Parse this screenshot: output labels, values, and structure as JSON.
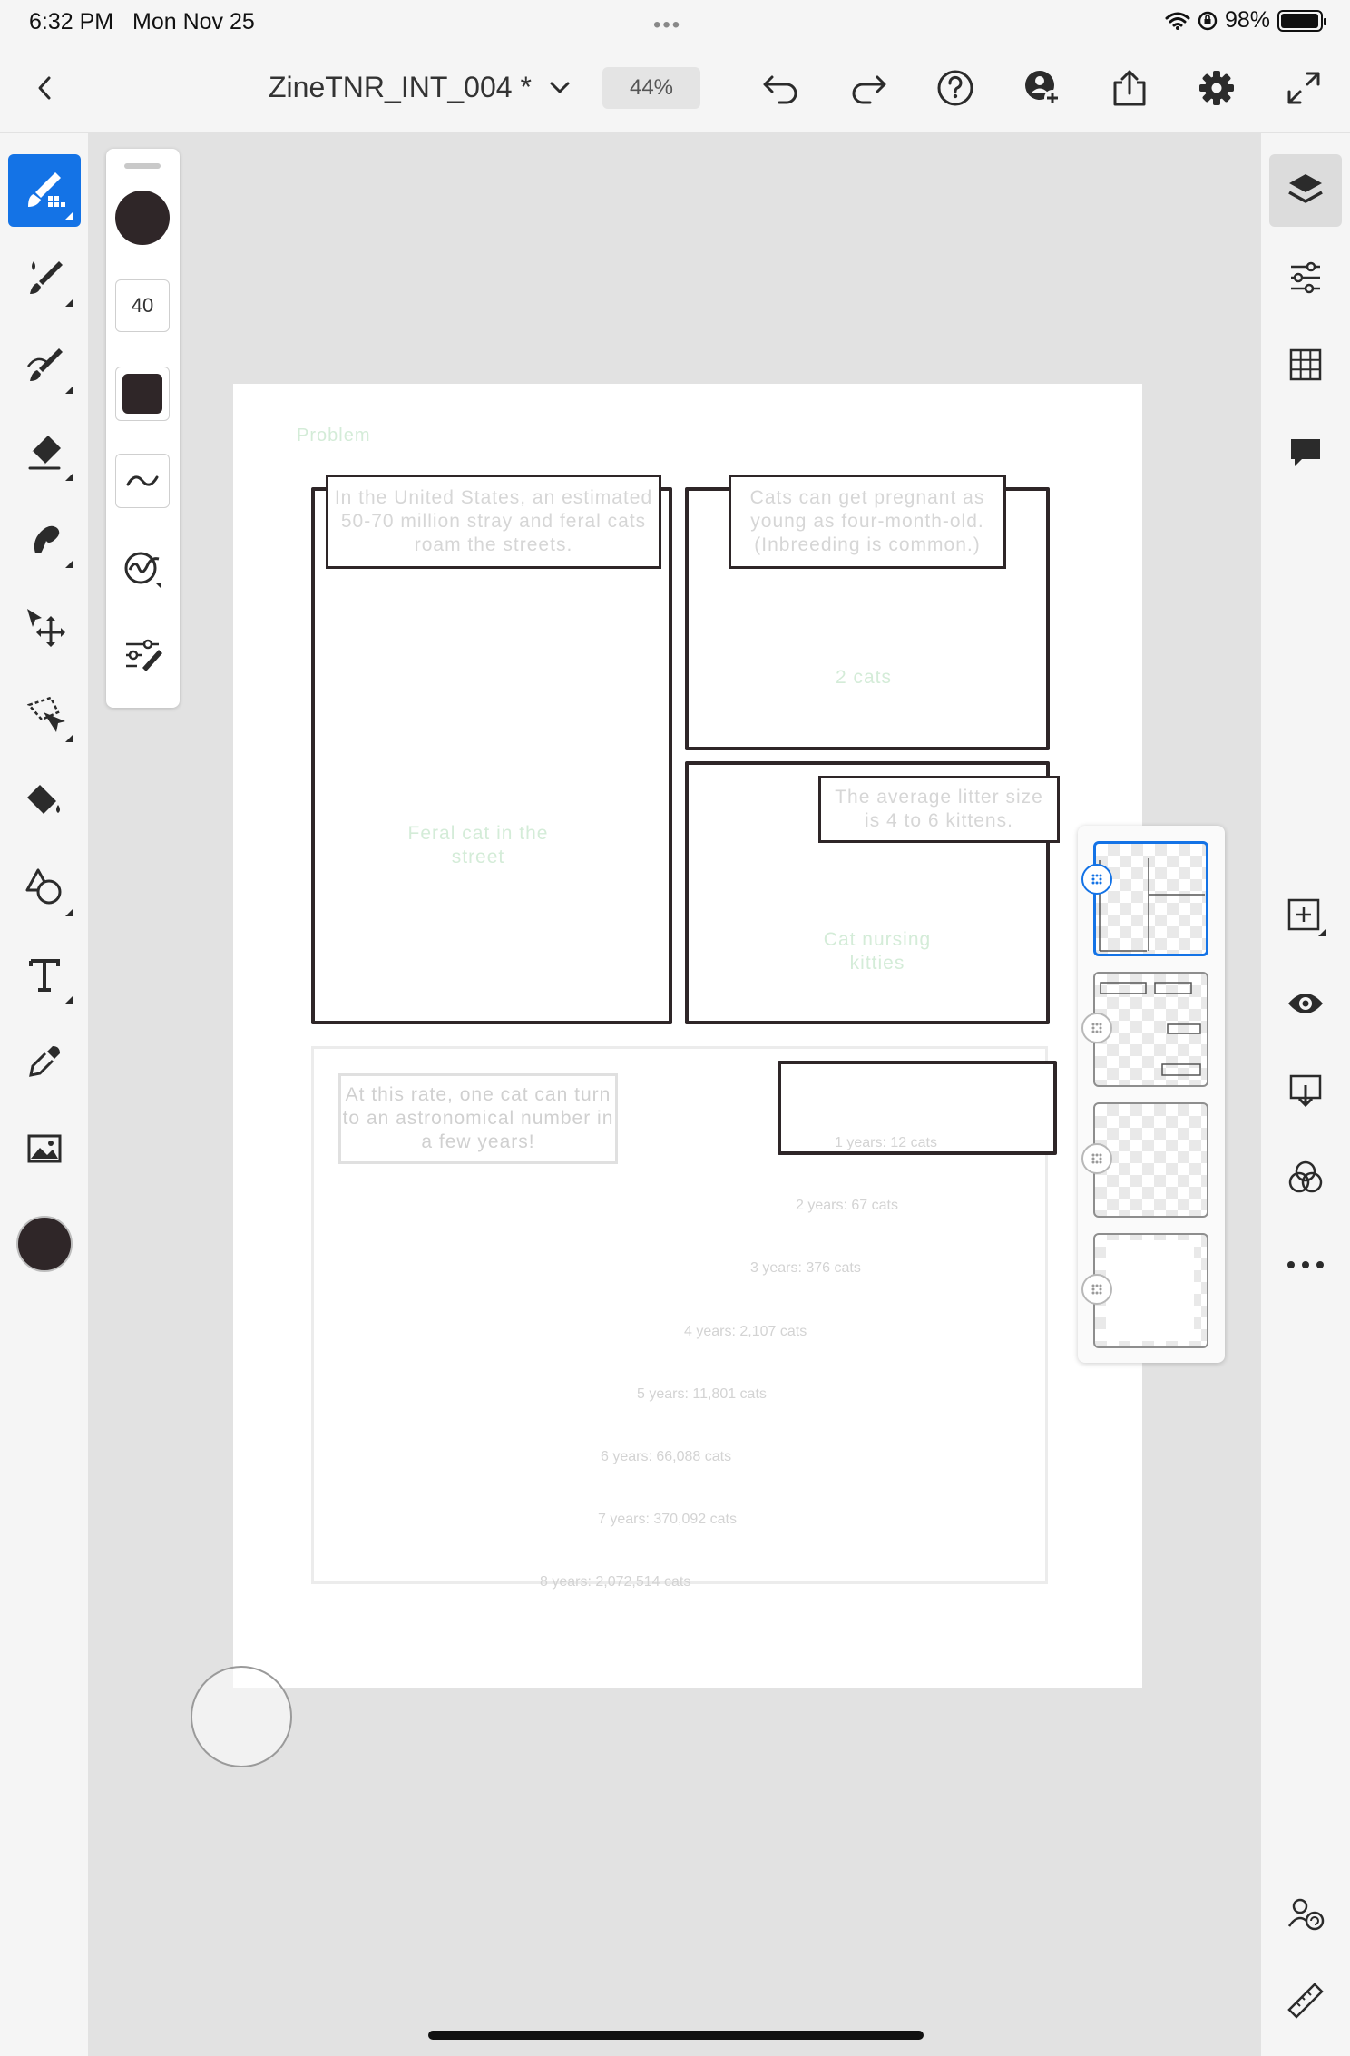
{
  "status_bar": {
    "time": "6:32 PM",
    "date": "Mon Nov 25",
    "dots": "•••",
    "battery": "98%",
    "battery_level": 0.98
  },
  "top_bar": {
    "doc_title": "ZineTNR_INT_004 *",
    "zoom": "44%",
    "icons": [
      "back-chevron-icon",
      "title-dropdown-icon",
      "undo-icon",
      "redo-icon",
      "help-icon",
      "invite-user-icon",
      "share-icon",
      "settings-icon",
      "fullscreen-icon"
    ]
  },
  "left_toolbar": {
    "tools": [
      "pixel-brush",
      "live-brush",
      "vector-brush",
      "eraser",
      "smudge",
      "transform",
      "selection",
      "fill",
      "shapes",
      "text",
      "eyedropper",
      "image"
    ],
    "active_tool": "pixel-brush",
    "color": "#2f2628"
  },
  "brush_panel": {
    "size": "40",
    "color": "#2f2628"
  },
  "right_toolbar": {
    "icons": [
      "layers-icon",
      "layer-properties-icon",
      "grid-icon",
      "comment-icon",
      "add-layer-icon",
      "visibility-icon",
      "merge-down-icon",
      "blend-mode-icon",
      "more-icon",
      "collaborate-icon",
      "ruler-icon"
    ]
  },
  "canvas": {
    "heading": "Problem",
    "panel1_caption": "In the United States, an estimated 50-70 million stray and feral cats roam the streets.",
    "panel1_label": "Feral cat in the street",
    "panel2_caption": "Cats can get pregnant as young as four-month-old. (Inbreeding is common.)",
    "panel2_label": "2 cats",
    "panel3_caption": "The average litter size is 4 to 6 kittens.",
    "panel3_label": "Cat nursing kitties",
    "panel4_caption": "At this rate, one cat can turn to an astronomical number in a few years!",
    "growth": [
      "1 years: 12 cats",
      "2 years: 67 cats",
      "3 years: 376 cats",
      "4 years: 2,107 cats",
      "5 years: 11,801 cats",
      "6 years: 66,088 cats",
      "7 years: 370,092 cats",
      "8 years: 2,072,514 cats"
    ]
  },
  "layers": {
    "count": 4,
    "selected_index": 0
  },
  "colors": {
    "accent": "#1473e6",
    "ink": "#2e2628",
    "chrome": "#f5f5f5",
    "canvas_bg": "#e2e2e2"
  }
}
